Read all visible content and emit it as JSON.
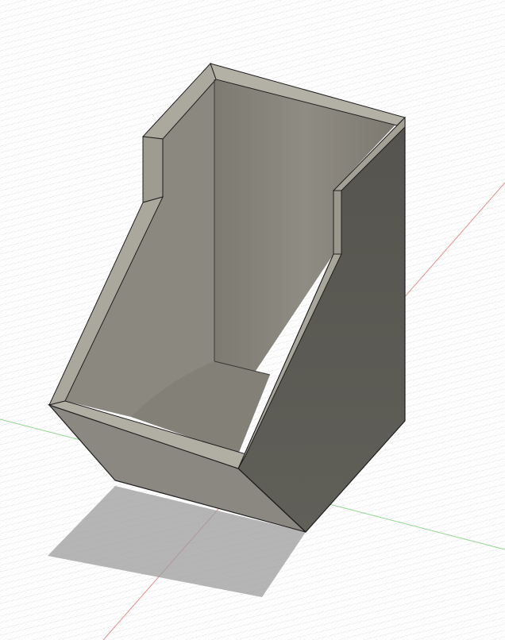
{
  "viewport": {
    "background": "#ffffff",
    "grid_minor_color": "#d9d9d9",
    "grid_major_color": "#c2c2c2",
    "x_axis_color": "#e88d8d",
    "z_axis_color": "#8fd88f"
  },
  "model": {
    "body_color": "#8a8880",
    "dark_face_color": "#5c5b55",
    "inner_wall_color": "#858279",
    "floor_color": "#7d7b73",
    "rim_color": "#b3b0a6",
    "edge_color": "#1e1e1e",
    "shadow_color": "#9c9c9c"
  },
  "icons": {
    "origin": "axis-origin-icon"
  }
}
